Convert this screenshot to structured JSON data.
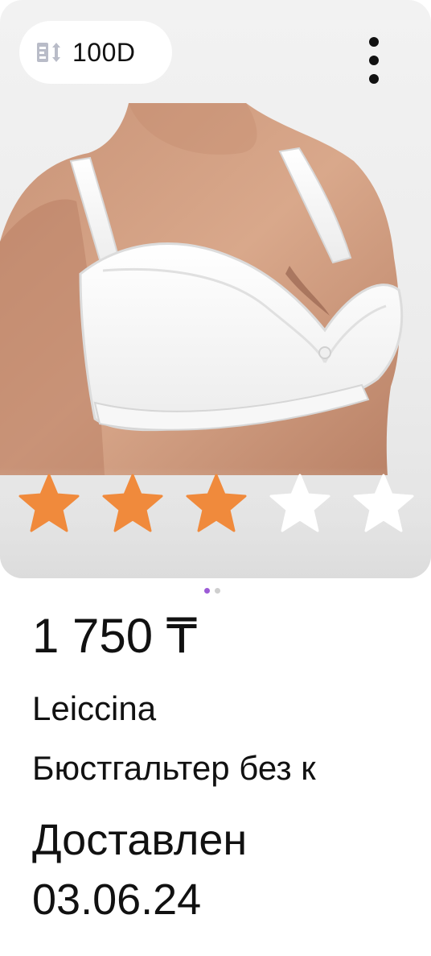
{
  "product_card": {
    "size_badge": {
      "label": "100D",
      "icon": "size-icon"
    },
    "menu_icon": "more-vertical-icon",
    "image_alt_subject": "white bra",
    "rating": {
      "value": 3,
      "max": 5,
      "filled_color": "#f08a3c",
      "empty_color": "#ffffff"
    },
    "pager": {
      "count": 2,
      "active_index": 0,
      "active_color": "#9c5bd6",
      "inactive_color": "#cfcfcf"
    },
    "price": "1 750 ₸",
    "brand": "Leiccina",
    "name": "Бюстгальтер без к",
    "delivery": {
      "status": "Доставлен",
      "date": "03.06.24"
    }
  }
}
